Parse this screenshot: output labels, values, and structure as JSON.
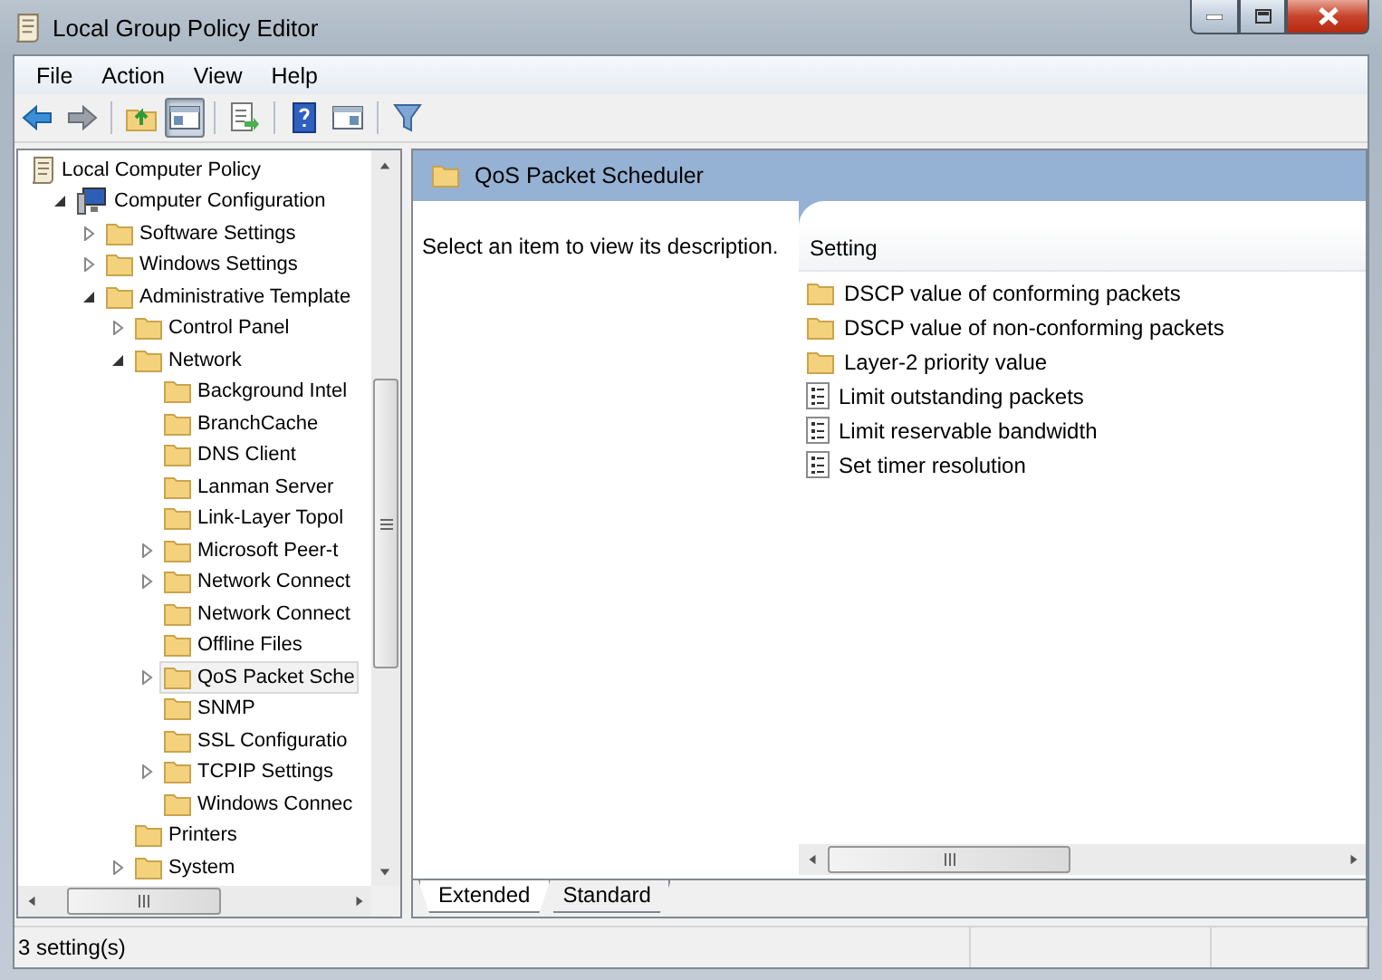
{
  "window": {
    "title": "Local Group Policy Editor"
  },
  "menu": [
    "File",
    "Action",
    "View",
    "Help"
  ],
  "toolbar": [
    {
      "kind": "back",
      "pressed": false
    },
    {
      "kind": "forward",
      "pressed": false
    },
    {
      "kind": "sep"
    },
    {
      "kind": "up",
      "pressed": false
    },
    {
      "kind": "tree",
      "pressed": true
    },
    {
      "kind": "sep"
    },
    {
      "kind": "export",
      "pressed": false
    },
    {
      "kind": "sep"
    },
    {
      "kind": "help",
      "pressed": false
    },
    {
      "kind": "pane",
      "pressed": false
    },
    {
      "kind": "sep"
    },
    {
      "kind": "filter",
      "pressed": false
    }
  ],
  "tree": [
    {
      "label": "Local Computer Policy",
      "kind": "policy",
      "selected": false,
      "children": [
        {
          "label": "Computer Configuration",
          "kind": "computer",
          "expanded": true,
          "selected": false,
          "children": [
            {
              "label": "Software Settings",
              "kind": "folder",
              "expanded": false,
              "selected": false
            },
            {
              "label": "Windows Settings",
              "kind": "folder",
              "expanded": false,
              "selected": false
            },
            {
              "label": "Administrative Template",
              "kind": "folder",
              "expanded": true,
              "selected": false,
              "children": [
                {
                  "label": "Control Panel",
                  "kind": "folder",
                  "expanded": false,
                  "selected": false
                },
                {
                  "label": "Network",
                  "kind": "folder",
                  "expanded": true,
                  "selected": false,
                  "children": [
                    {
                      "label": "Background Intel",
                      "kind": "folder",
                      "selected": false
                    },
                    {
                      "label": "BranchCache",
                      "kind": "folder",
                      "selected": false
                    },
                    {
                      "label": "DNS Client",
                      "kind": "folder",
                      "selected": false
                    },
                    {
                      "label": "Lanman Server",
                      "kind": "folder",
                      "selected": false
                    },
                    {
                      "label": "Link-Layer Topol",
                      "kind": "folder",
                      "selected": false
                    },
                    {
                      "label": "Microsoft Peer-t",
                      "kind": "folder",
                      "expanded": false,
                      "selected": false
                    },
                    {
                      "label": "Network Connect",
                      "kind": "folder",
                      "expanded": false,
                      "selected": false
                    },
                    {
                      "label": "Network Connect",
                      "kind": "folder",
                      "selected": false
                    },
                    {
                      "label": "Offline Files",
                      "kind": "folder",
                      "selected": false
                    },
                    {
                      "label": "QoS Packet Sche",
                      "kind": "folder",
                      "expanded": false,
                      "selected": true
                    },
                    {
                      "label": "SNMP",
                      "kind": "folder",
                      "selected": false
                    },
                    {
                      "label": "SSL Configuratio",
                      "kind": "folder",
                      "selected": false
                    },
                    {
                      "label": "TCPIP Settings",
                      "kind": "folder",
                      "expanded": false,
                      "selected": false
                    },
                    {
                      "label": "Windows Connec",
                      "kind": "folder",
                      "selected": false
                    }
                  ]
                },
                {
                  "label": "Printers",
                  "kind": "folder",
                  "selected": false
                },
                {
                  "label": "System",
                  "kind": "folder",
                  "expanded": false,
                  "selected": false
                }
              ]
            }
          ]
        }
      ]
    }
  ],
  "details": {
    "title": "QoS Packet Scheduler",
    "description": "Select an item to view its description.",
    "column": "Setting",
    "rows": [
      {
        "label": "DSCP value of conforming packets",
        "kind": "folder"
      },
      {
        "label": "DSCP value of non-conforming packets",
        "kind": "folder"
      },
      {
        "label": "Layer-2 priority value",
        "kind": "folder"
      },
      {
        "label": "Limit outstanding packets",
        "kind": "setting"
      },
      {
        "label": "Limit reservable bandwidth",
        "kind": "setting"
      },
      {
        "label": "Set timer resolution",
        "kind": "setting"
      }
    ]
  },
  "view_tabs": [
    {
      "label": "Extended",
      "selected": true
    },
    {
      "label": "Standard",
      "selected": false
    }
  ],
  "status_bar": "3 setting(s)"
}
